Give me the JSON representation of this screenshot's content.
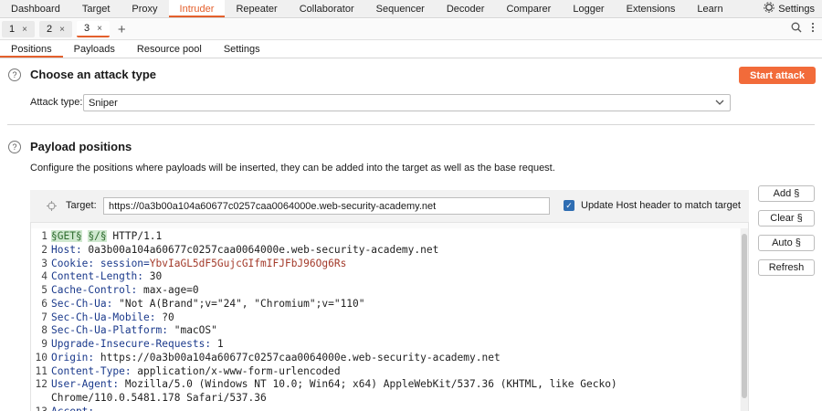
{
  "menu": {
    "tabs": [
      "Dashboard",
      "Target",
      "Proxy",
      "Intruder",
      "Repeater",
      "Collaborator",
      "Sequencer",
      "Decoder",
      "Comparer",
      "Logger",
      "Extensions",
      "Learn"
    ],
    "active": "Intruder",
    "settings_label": "Settings"
  },
  "attack_tabs": [
    {
      "label": "1",
      "close": "×"
    },
    {
      "label": "2",
      "close": "×"
    },
    {
      "label": "3",
      "close": "×"
    }
  ],
  "add_tab_symbol": "+",
  "section_tabs": [
    "Positions",
    "Payloads",
    "Resource pool",
    "Settings"
  ],
  "attack_type": {
    "heading": "Choose an attack type",
    "label": "Attack type:",
    "value": "Sniper",
    "start_button": "Start attack"
  },
  "payload_positions": {
    "heading": "Payload positions",
    "description": "Configure the positions where payloads will be inserted, they can be added into the target as well as the base request.",
    "target_label": "Target:",
    "target_value": "https://0a3b00a104a60677c0257caa0064000e.web-security-academy.net",
    "update_host_label": "Update Host header to match target",
    "update_host_checked": true
  },
  "side_buttons": [
    "Add §",
    "Clear §",
    "Auto §",
    "Refresh"
  ],
  "request_lines": [
    {
      "n": "1",
      "parts": [
        {
          "t": "§GET§",
          "c": "marker"
        },
        {
          "t": " ",
          "c": "v"
        },
        {
          "t": "§/§",
          "c": "marker"
        },
        {
          "t": " HTTP/1.1",
          "c": "v"
        }
      ]
    },
    {
      "n": "2",
      "parts": [
        {
          "t": "Host:",
          "c": "k"
        },
        {
          "t": " 0a3b00a104a60677c0257caa0064000e.web-security-academy.net",
          "c": "v"
        }
      ]
    },
    {
      "n": "3",
      "parts": [
        {
          "t": "Cookie:",
          "c": "k"
        },
        {
          "t": " session=",
          "c": "k"
        },
        {
          "t": "YbvIaGL5dF5GujcGIfmIFJFbJ96Og6Rs",
          "c": "cookie"
        }
      ]
    },
    {
      "n": "4",
      "parts": [
        {
          "t": "Content-Length:",
          "c": "k"
        },
        {
          "t": " 30",
          "c": "v"
        }
      ]
    },
    {
      "n": "5",
      "parts": [
        {
          "t": "Cache-Control:",
          "c": "k"
        },
        {
          "t": " max-age=0",
          "c": "v"
        }
      ]
    },
    {
      "n": "6",
      "parts": [
        {
          "t": "Sec-Ch-Ua:",
          "c": "k"
        },
        {
          "t": " \"Not A(Brand\";v=\"24\", \"Chromium\";v=\"110\"",
          "c": "v"
        }
      ]
    },
    {
      "n": "7",
      "parts": [
        {
          "t": "Sec-Ch-Ua-Mobile:",
          "c": "k"
        },
        {
          "t": " ?0",
          "c": "v"
        }
      ]
    },
    {
      "n": "8",
      "parts": [
        {
          "t": "Sec-Ch-Ua-Platform:",
          "c": "k"
        },
        {
          "t": " \"macOS\"",
          "c": "v"
        }
      ]
    },
    {
      "n": "9",
      "parts": [
        {
          "t": "Upgrade-Insecure-Requests:",
          "c": "k"
        },
        {
          "t": " 1",
          "c": "v"
        }
      ]
    },
    {
      "n": "10",
      "parts": [
        {
          "t": "Origin:",
          "c": "k"
        },
        {
          "t": " https://0a3b00a104a60677c0257caa0064000e.web-security-academy.net",
          "c": "v"
        }
      ]
    },
    {
      "n": "11",
      "parts": [
        {
          "t": "Content-Type:",
          "c": "k"
        },
        {
          "t": " application/x-www-form-urlencoded",
          "c": "v"
        }
      ]
    },
    {
      "n": "12",
      "parts": [
        {
          "t": "User-Agent:",
          "c": "k"
        },
        {
          "t": " Mozilla/5.0 (Windows NT 10.0; Win64; x64) AppleWebKit/537.36 (KHTML, like Gecko)",
          "c": "v"
        }
      ]
    },
    {
      "n": "",
      "parts": [
        {
          "t": "Chrome/110.0.5481.178 Safari/537.36",
          "c": "v"
        }
      ]
    },
    {
      "n": "13",
      "parts": [
        {
          "t": "Accept:",
          "c": "k"
        }
      ]
    }
  ],
  "colors": {
    "accent": "#e4602d",
    "start_button": "#f26b3a",
    "header_key": "#1b3a8c",
    "cookie_value": "#a33a2a",
    "marker_bg": "#cfe8cf"
  }
}
